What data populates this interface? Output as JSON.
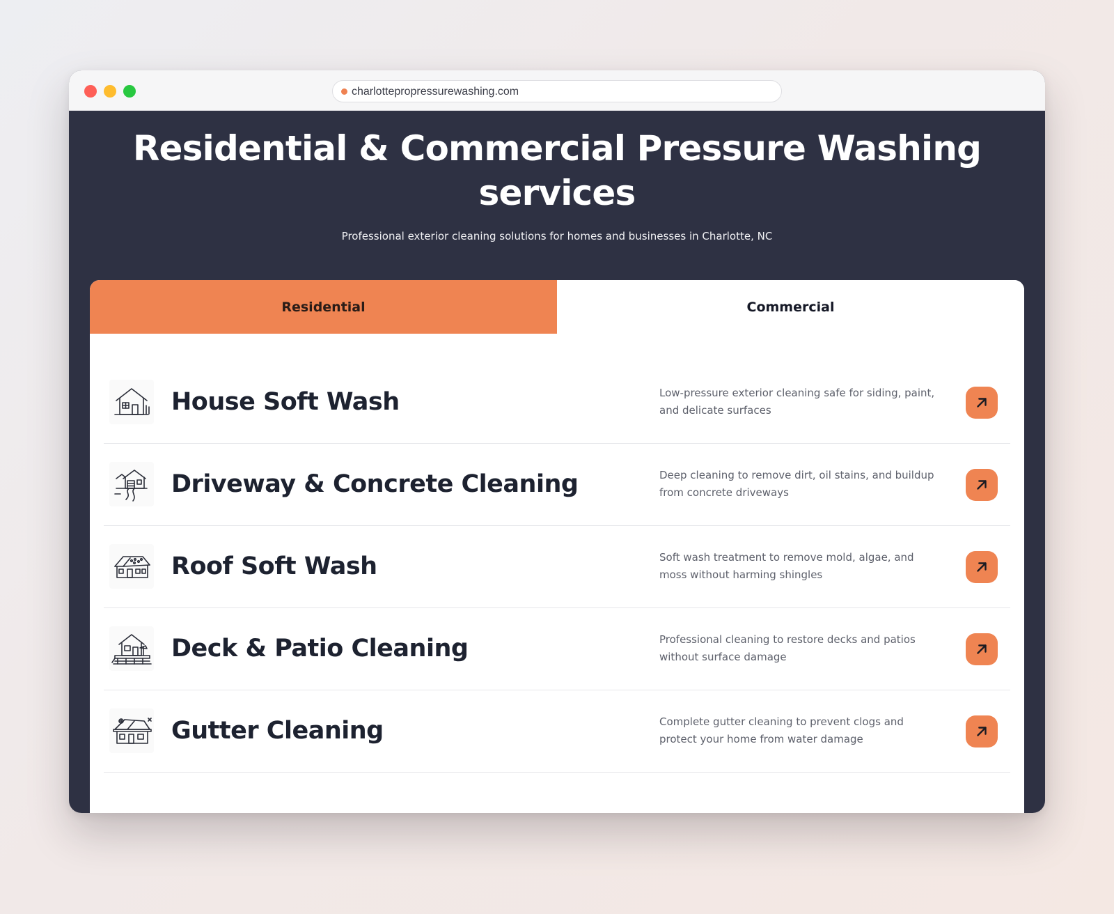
{
  "browser": {
    "url": "charlottepropressurewashing.com"
  },
  "hero": {
    "title": "Residential & Commercial Pressure Washing services",
    "subtitle": "Professional exterior cleaning solutions for homes and businesses in Charlotte, NC"
  },
  "tabs": [
    {
      "label": "Residential",
      "active": true
    },
    {
      "label": "Commercial",
      "active": false
    }
  ],
  "services": [
    {
      "title": "House Soft Wash",
      "description": "Low-pressure exterior cleaning safe for siding, paint, and delicate surfaces",
      "icon": "house-icon"
    },
    {
      "title": "Driveway & Concrete Cleaning",
      "description": "Deep cleaning to remove dirt, oil stains, and buildup from concrete driveways",
      "icon": "driveway-icon"
    },
    {
      "title": "Roof Soft Wash",
      "description": "Soft wash treatment to remove mold, algae, and moss without harming shingles",
      "icon": "roof-icon"
    },
    {
      "title": "Deck & Patio Cleaning",
      "description": "Professional cleaning to restore decks and patios without surface damage",
      "icon": "deck-icon"
    },
    {
      "title": "Gutter Cleaning",
      "description": "Complete gutter cleaning to prevent clogs and protect your home from water damage",
      "icon": "gutter-icon"
    }
  ],
  "colors": {
    "accent": "#ef8452",
    "background": "#2e3143",
    "title_text": "#1d2230"
  },
  "button_icon": "arrow-up-right-icon"
}
